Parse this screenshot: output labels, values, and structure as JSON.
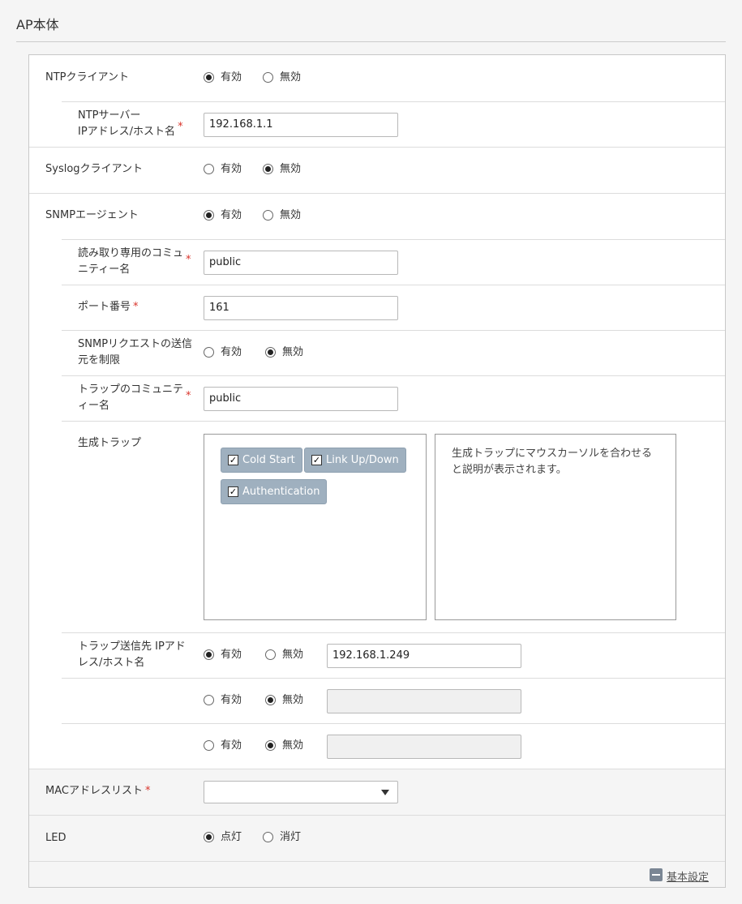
{
  "page": {
    "title": "AP本体"
  },
  "ntp": {
    "label": "NTPクライアント",
    "enable": "有効",
    "disable": "無効",
    "server_label_line1": "NTPサーバー",
    "server_label_line2": "IPアドレス/ホスト名",
    "server_value": "192.168.1.1",
    "selected": "有効"
  },
  "syslog": {
    "label": "Syslogクライアント",
    "enable": "有効",
    "disable": "無効",
    "selected": "無効"
  },
  "snmp": {
    "label": "SNMPエージェント",
    "enable": "有効",
    "disable": "無効",
    "selected": "有効",
    "ro_community_line1": "読み取り専用のコミュ",
    "ro_community_line2": "ニティー名",
    "ro_community_value": "public",
    "port_label": "ポート番号",
    "port_value": "161",
    "restrict_line1": "SNMPリクエストの送信",
    "restrict_line2": "元を制限",
    "restrict_enable": "有効",
    "restrict_disable": "無効",
    "restrict_selected": "無効",
    "trap_community_line1": "トラップのコミュニテ",
    "trap_community_line2": "ィー名",
    "trap_community_value": "public",
    "traps_label": "生成トラップ",
    "traps": [
      "Cold Start",
      "Link Up/Down",
      "Authentication"
    ],
    "traps_description": [
      "生成トラップにマウスカーソルを合わせる",
      "と説明が表示されます。"
    ],
    "trap_dest_line1": "トラップ送信先 IPアド",
    "trap_dest_line2": "レス/ホスト名",
    "trap_dests": [
      {
        "enable": "有効",
        "disable": "無効",
        "selected": "有効",
        "value": "192.168.1.249"
      },
      {
        "enable": "有効",
        "disable": "無効",
        "selected": "無効",
        "value": ""
      },
      {
        "enable": "有効",
        "disable": "無効",
        "selected": "無効",
        "value": ""
      }
    ]
  },
  "mac": {
    "label": "MACアドレスリスト",
    "selected": ""
  },
  "led": {
    "label": "LED",
    "on": "点灯",
    "off": "消灯",
    "selected": "点灯"
  },
  "required_mark": "*",
  "footer": {
    "link": "基本設定"
  }
}
